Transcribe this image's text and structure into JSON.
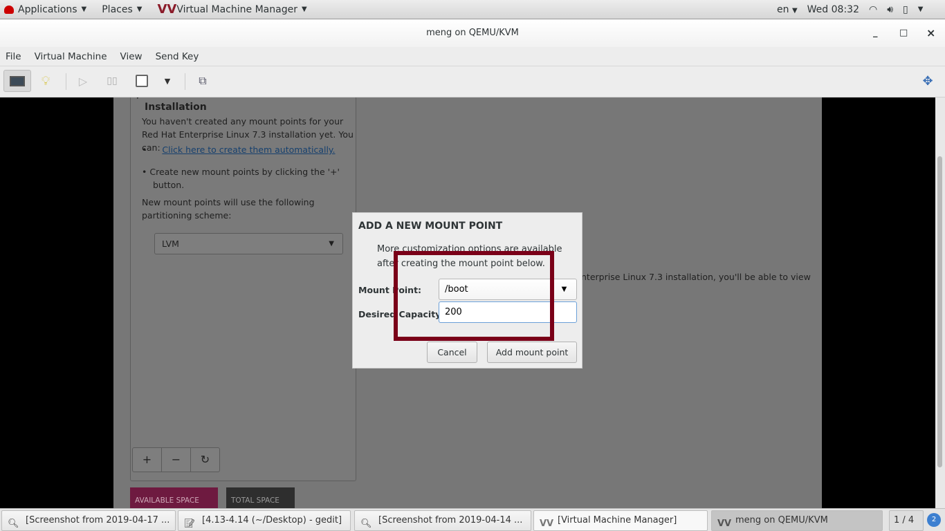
{
  "topbar": {
    "applications": "Applications",
    "places": "Places",
    "app_menu": "Virtual Machine Manager",
    "lang": "en",
    "clock": "Wed 08:32"
  },
  "window": {
    "title": "meng on QEMU/KVM",
    "minimize": "_",
    "maximize": "□",
    "close": "×"
  },
  "menu": [
    "File",
    "Virtual Machine",
    "View",
    "Send Key"
  ],
  "toolbar": {
    "icons": [
      "console-icon",
      "lightbulb-icon",
      "play-icon",
      "pause-icon",
      "power-icon",
      "dropdown-icon",
      "snapshots-icon",
      "fullscreen-icon"
    ]
  },
  "installer": {
    "section_title": "Installation",
    "intro": "You haven't created any mount points for your Red Hat Enterprise Linux 7.3 installation yet.  You can:",
    "auto_link": "Click here to create them automatically.",
    "manual": "Create new mount points by clicking the '+' button.",
    "scheme_label": "New mount points will use the following partitioning scheme:",
    "scheme_value": "LVM",
    "add": "+",
    "remove": "−",
    "refresh": "↻",
    "available_space": "AVAILABLE SPACE",
    "total_space": "TOTAL SPACE",
    "right_text": "nterprise Linux 7.3 installation, you'll be able to view"
  },
  "dialog": {
    "title": "ADD A NEW MOUNT POINT",
    "desc1": "More customization options are available",
    "desc2": "after creating the mount point below.",
    "mount_label": "Mount Point:",
    "mount_value": "/boot",
    "capacity_label": "Desired Capacity:",
    "capacity_value": "200",
    "cancel": "Cancel",
    "add": "Add mount point"
  },
  "highlight_color": "#7a0018",
  "taskbar": {
    "items": [
      "[Screenshot from 2019-04-17 ...",
      "[4.13-4.14 (~/Desktop) - gedit]",
      "[Screenshot from 2019-04-14 ...",
      "[Virtual Machine Manager]",
      "meng on QEMU/KVM"
    ],
    "workspace": "1 / 4"
  }
}
